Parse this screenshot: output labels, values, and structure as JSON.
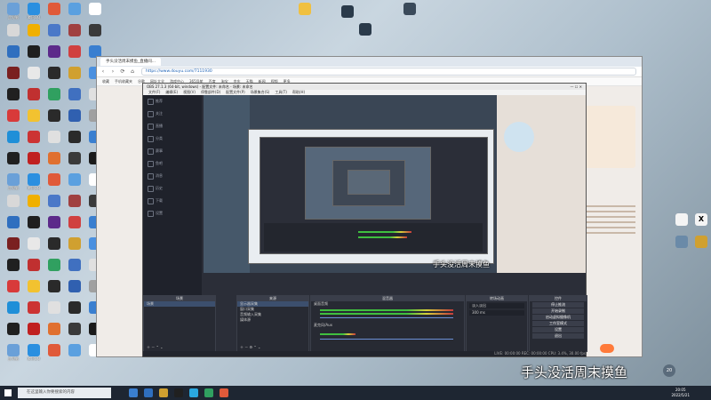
{
  "desktop_icons": [
    {
      "label": "此电脑",
      "color": "#6aa0d8"
    },
    {
      "label": "腾讯QQ",
      "color": "#2a8fe0"
    },
    {
      "label": "",
      "color": "#e05a3a"
    },
    {
      "label": "",
      "color": "#5aa0e0"
    },
    {
      "label": "",
      "color": "#ffffff"
    },
    {
      "label": "",
      "color": "#d8d8d8"
    },
    {
      "label": "",
      "color": "#f0b000"
    },
    {
      "label": "",
      "color": "#4a78c8"
    },
    {
      "label": "",
      "color": "#a04040"
    },
    {
      "label": "",
      "color": "#3a3a3a"
    },
    {
      "label": "",
      "color": "#2f6fbf"
    },
    {
      "label": "",
      "color": "#1f1f1f"
    },
    {
      "label": "",
      "color": "#5c2a8a"
    },
    {
      "label": "",
      "color": "#d04040"
    },
    {
      "label": "",
      "color": "#3a7fd0"
    },
    {
      "label": "",
      "color": "#7a2020"
    },
    {
      "label": "",
      "color": "#e8e8e8"
    },
    {
      "label": "",
      "color": "#2a2a2a"
    },
    {
      "label": "",
      "color": "#d0a030"
    },
    {
      "label": "",
      "color": "#4a90e0"
    },
    {
      "label": "",
      "color": "#202020"
    },
    {
      "label": "",
      "color": "#c03030"
    },
    {
      "label": "",
      "color": "#30a060"
    },
    {
      "label": "",
      "color": "#4070c0"
    },
    {
      "label": "",
      "color": "#e0e0e0"
    },
    {
      "label": "",
      "color": "#d83a3a"
    },
    {
      "label": "",
      "color": "#f2c230"
    },
    {
      "label": "",
      "color": "#2a2a2a"
    },
    {
      "label": "",
      "color": "#3060b0"
    },
    {
      "label": "",
      "color": "#a0a0a0"
    },
    {
      "label": "",
      "color": "#1f8fd8"
    },
    {
      "label": "",
      "color": "#cc3333"
    },
    {
      "label": "",
      "color": "#e0e0e0"
    },
    {
      "label": "",
      "color": "#2a2a2a"
    },
    {
      "label": "",
      "color": "#3a7fd0"
    },
    {
      "label": "",
      "color": "#202020"
    },
    {
      "label": "",
      "color": "#c02020"
    },
    {
      "label": "",
      "color": "#e07030"
    },
    {
      "label": "",
      "color": "#3a3a3a"
    },
    {
      "label": "",
      "color": "#1a1a1a"
    }
  ],
  "browser": {
    "tab_title": "手头没活周末摸鱼_直播间...",
    "url": "https://www.douyu.com/7111930",
    "bookmarks": [
      "收藏",
      "手机收藏夹",
      "谷歌",
      "网址大全",
      "游戏中心",
      "365导航",
      "百度",
      "淘宝",
      "京东",
      "天猫",
      "新闻",
      "视频",
      "更多"
    ],
    "nav": {
      "back": "‹",
      "forward": "›",
      "refresh": "⟳",
      "home": "⌂"
    }
  },
  "obs": {
    "title": "OBS 27.1.3 (64-bit, windows) - 配置文件: 未命名 - 场景: 未命名",
    "menu": [
      "文件(F)",
      "编辑(E)",
      "视图(V)",
      "停靠部件(D)",
      "配置文件(P)",
      "场景集合(S)",
      "工具(T)",
      "帮助(H)"
    ],
    "left_nav": [
      "推荐",
      "关注",
      "直播",
      "分类",
      "赛事",
      "鱼吧",
      "消息",
      "历史",
      "下载",
      "设置"
    ],
    "docks": {
      "scenes": {
        "title": "场景",
        "items": [
          "场景"
        ]
      },
      "sources": {
        "title": "来源",
        "items": [
          "显示器采集",
          "窗口采集",
          "音频输入采集",
          "媒体源"
        ]
      },
      "mixer": {
        "title": "混音器",
        "tracks": [
          "桌面音频",
          "麦克风/Aux"
        ],
        "level": "0.0 dB"
      },
      "transitions": {
        "title": "转场动画",
        "type": "淡入淡出",
        "duration": "300 ms"
      },
      "controls": {
        "title": "控件",
        "buttons": [
          "停止推流",
          "开始录制",
          "启动虚拟摄像机",
          "工作室模式",
          "设置",
          "退出"
        ]
      }
    },
    "status": "LIVE: 00:00:00   REC: 00:00:00   CPU: 3.4%, 30.00 fps"
  },
  "caption_small": "手头没活周末摸鱼",
  "caption_large": "手头没活周末摸鱼",
  "taskbar": {
    "search_placeholder": "在这里输入你要搜索的内容",
    "time": "20:05",
    "date": "2022/5/21",
    "badge": "20"
  }
}
